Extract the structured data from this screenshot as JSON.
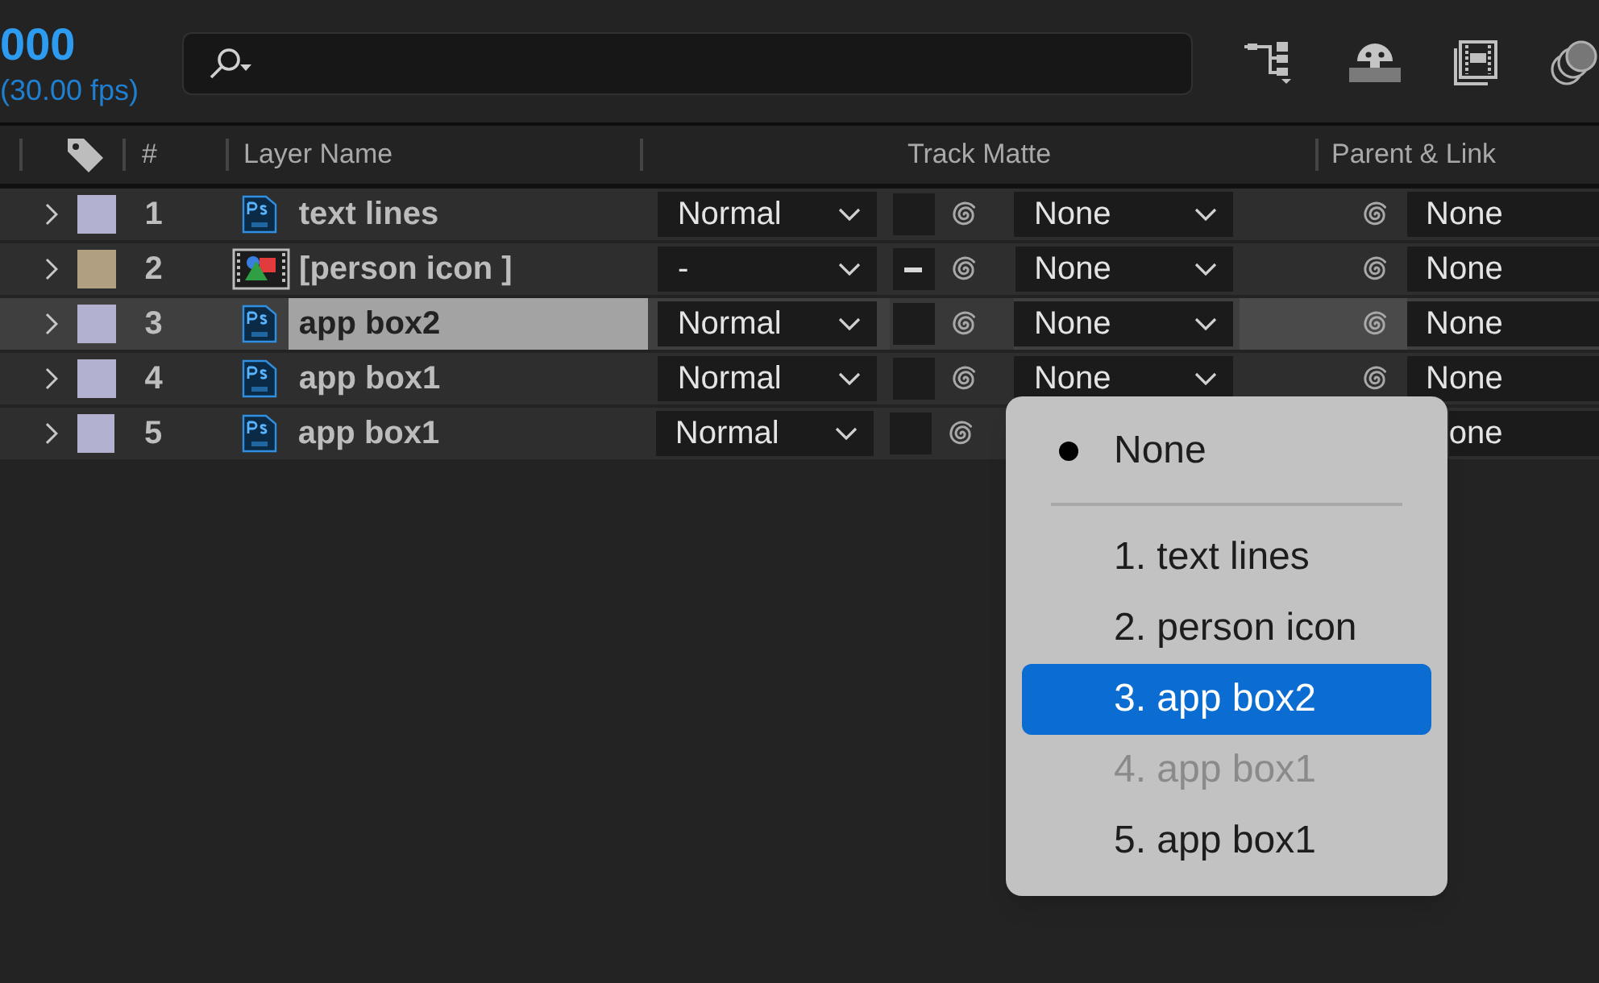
{
  "timecode": "000",
  "fps": "(30.00 fps)",
  "columns": {
    "number": "#",
    "layer_name": "Layer Name",
    "track_matte": "Track Matte",
    "parent": "Parent & Link"
  },
  "layers": [
    {
      "number": "1",
      "color": "#b2b1d0",
      "kind": "psd",
      "name": "text lines",
      "selected": false,
      "mode": "Normal",
      "matte_mixed": false,
      "matte": "None",
      "parent": "None"
    },
    {
      "number": "2",
      "color": "#b09f80",
      "kind": "footage",
      "name": "[person icon ]",
      "selected": false,
      "mode": "-",
      "matte_mixed": true,
      "matte": "None",
      "parent": "None"
    },
    {
      "number": "3",
      "color": "#b2b1d0",
      "kind": "psd",
      "name": "app box2",
      "selected": true,
      "mode": "Normal",
      "matte_mixed": false,
      "matte": "None",
      "parent": "None"
    },
    {
      "number": "4",
      "color": "#b2b1d0",
      "kind": "psd",
      "name": "app box1",
      "selected": false,
      "mode": "Normal",
      "matte_mixed": false,
      "matte": "None",
      "parent": "None"
    },
    {
      "number": "5",
      "color": "#b2b1d0",
      "kind": "psd",
      "name": "app box1",
      "selected": false,
      "mode": "Normal",
      "matte_mixed": false,
      "parent": "one"
    }
  ],
  "menu": [
    {
      "kind": "option",
      "label": "None",
      "checked": true,
      "selected": false,
      "disabled": false
    },
    {
      "kind": "separator"
    },
    {
      "kind": "option",
      "label": "1. text lines",
      "checked": false,
      "selected": false,
      "disabled": false
    },
    {
      "kind": "option",
      "label": "2. person icon",
      "checked": false,
      "selected": false,
      "disabled": false
    },
    {
      "kind": "option",
      "label": "3. app box2",
      "checked": false,
      "selected": true,
      "disabled": false
    },
    {
      "kind": "option",
      "label": "4. app box1",
      "checked": false,
      "selected": false,
      "disabled": true
    },
    {
      "kind": "option",
      "label": "5. app box1",
      "checked": false,
      "selected": false,
      "disabled": false
    }
  ]
}
